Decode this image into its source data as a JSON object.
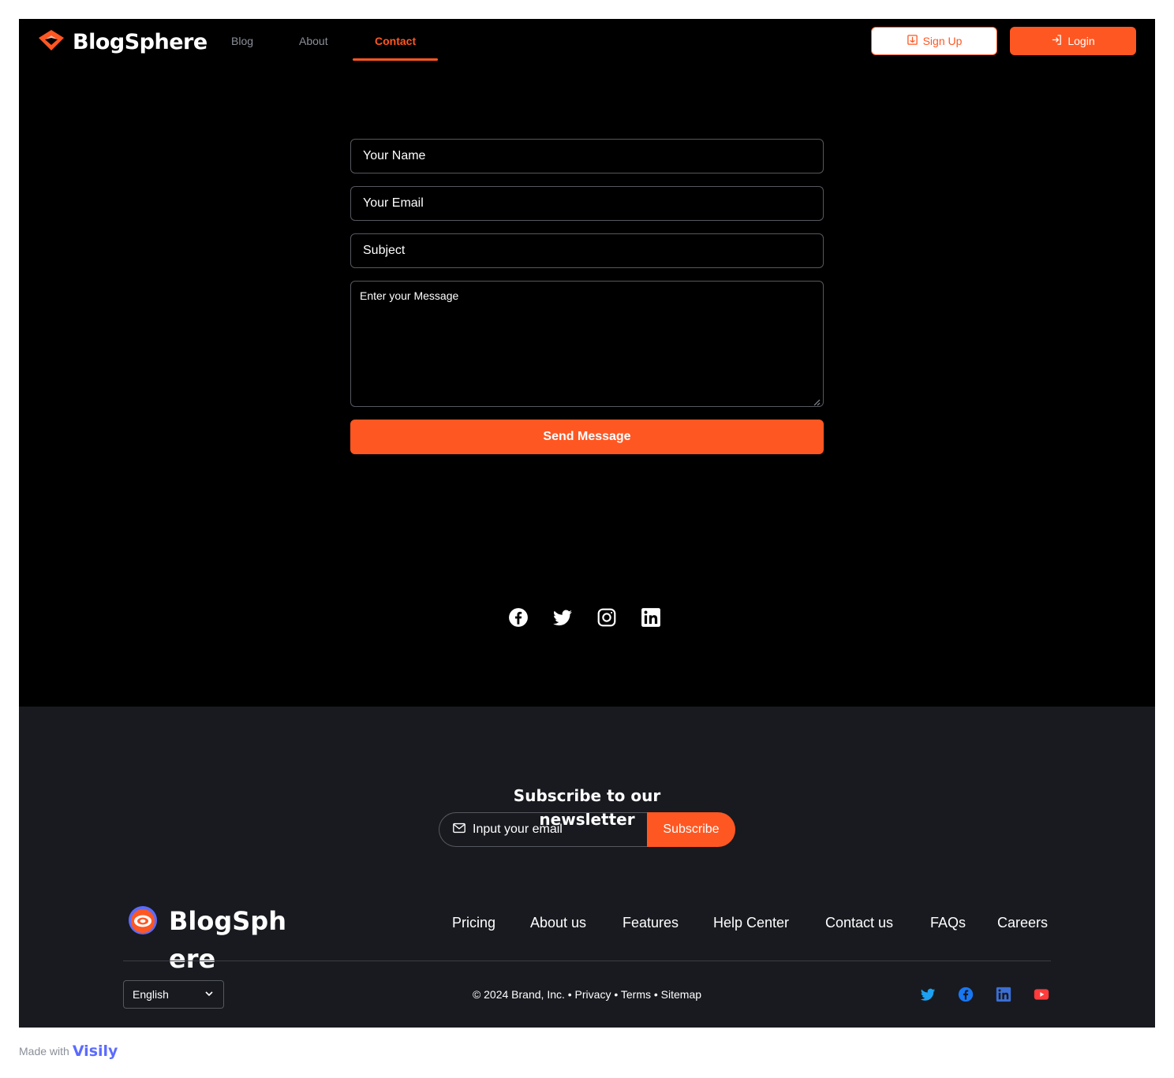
{
  "header": {
    "brand": "BlogSphere",
    "nav": [
      {
        "label": "Blog",
        "active": false
      },
      {
        "label": "About",
        "active": false
      },
      {
        "label": "Contact",
        "active": true
      }
    ],
    "signup_label": "Sign Up",
    "login_label": "Login"
  },
  "contact_form": {
    "name_placeholder": "Your Name",
    "email_placeholder": "Your Email",
    "subject_placeholder": "Subject",
    "message_placeholder": "Enter your Message",
    "send_label": "Send Message"
  },
  "social": [
    "facebook-icon",
    "twitter-icon",
    "instagram-icon",
    "linkedin-icon"
  ],
  "footer": {
    "subscribe_title": "Subscribe to our newsletter",
    "email_placeholder": "Input your email",
    "subscribe_label": "Subscribe",
    "brand": "BlogSphere",
    "links": [
      "Pricing",
      "About us",
      "Features",
      "Help Center",
      "Contact us",
      "FAQs",
      "Careers"
    ],
    "language": "English",
    "copyright": "© 2024 Brand, Inc. • Privacy • Terms • Sitemap",
    "social": [
      "twitter-icon",
      "facebook-icon",
      "linkedin-icon",
      "youtube-icon"
    ]
  },
  "made_with": {
    "label": "Made with",
    "brand": "Visily"
  },
  "colors": {
    "accent": "#ff5722",
    "header_bg": "#000000",
    "footer_bg": "#181a1f"
  }
}
